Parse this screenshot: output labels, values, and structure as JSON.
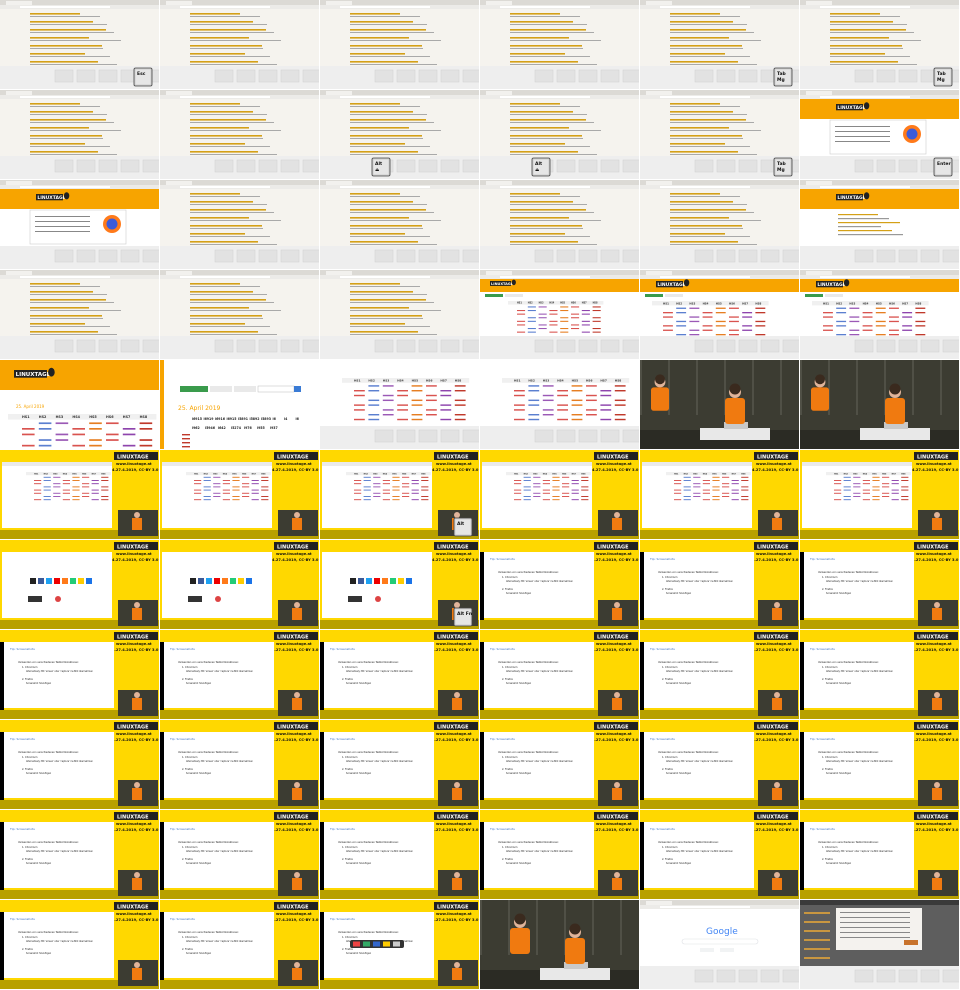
{
  "contact_sheet": {
    "columns": 6,
    "rows": 11,
    "frames": [
      {
        "type": "browser",
        "key": "Esc"
      },
      {
        "type": "browser"
      },
      {
        "type": "browser"
      },
      {
        "type": "browser"
      },
      {
        "type": "browser",
        "key": "Tab\nMg"
      },
      {
        "type": "browser",
        "key": "Tab\nMg"
      },
      {
        "type": "browser"
      },
      {
        "type": "browser"
      },
      {
        "type": "browser",
        "key": "Alt\n⏏"
      },
      {
        "type": "browser",
        "key": "Alt\n⏏"
      },
      {
        "type": "browser",
        "key": "Tab\nMg"
      },
      {
        "type": "lt_dialog",
        "key": "Enter"
      },
      {
        "type": "lt_dialog"
      },
      {
        "type": "browser"
      },
      {
        "type": "browser"
      },
      {
        "type": "browser"
      },
      {
        "type": "browser"
      },
      {
        "type": "lt_page"
      },
      {
        "type": "browser"
      },
      {
        "type": "browser"
      },
      {
        "type": "browser"
      },
      {
        "type": "lt_schedule"
      },
      {
        "type": "lt_schedule_zoom"
      },
      {
        "type": "lt_schedule_zoom"
      },
      {
        "type": "lt_schedule_big"
      },
      {
        "type": "zoom_date"
      },
      {
        "type": "schedule_plain"
      },
      {
        "type": "schedule_plain"
      },
      {
        "type": "speaker"
      },
      {
        "type": "speaker"
      },
      {
        "type": "stream_schedule"
      },
      {
        "type": "stream_schedule"
      },
      {
        "type": "stream_schedule",
        "key": "Alt"
      },
      {
        "type": "stream_schedule"
      },
      {
        "type": "stream_schedule"
      },
      {
        "type": "stream_schedule"
      },
      {
        "type": "stream_browser"
      },
      {
        "type": "stream_browser"
      },
      {
        "type": "stream_browser",
        "key": "Alt Fn"
      },
      {
        "type": "stream_slide"
      },
      {
        "type": "stream_slide"
      },
      {
        "type": "stream_slide"
      },
      {
        "type": "stream_slide"
      },
      {
        "type": "stream_slide"
      },
      {
        "type": "stream_slide"
      },
      {
        "type": "stream_slide"
      },
      {
        "type": "stream_slide"
      },
      {
        "type": "stream_slide"
      },
      {
        "type": "stream_slide"
      },
      {
        "type": "stream_slide"
      },
      {
        "type": "stream_slide"
      },
      {
        "type": "stream_slide"
      },
      {
        "type": "stream_slide"
      },
      {
        "type": "stream_slide"
      },
      {
        "type": "stream_slide"
      },
      {
        "type": "stream_slide"
      },
      {
        "type": "stream_slide"
      },
      {
        "type": "stream_slide"
      },
      {
        "type": "stream_slide"
      },
      {
        "type": "stream_slide"
      },
      {
        "type": "stream_slide"
      },
      {
        "type": "stream_slide"
      },
      {
        "type": "stream_slide_dock"
      },
      {
        "type": "speaker2"
      },
      {
        "type": "google"
      },
      {
        "type": "dark_dialog"
      }
    ]
  },
  "text": {
    "linuxtage": "LINUXTAGE",
    "stream_url": "www.linuxtage.at",
    "stream_license": "4.27.4.2019, CC-BY 3.0",
    "zoom_date": "25. April 2019",
    "google": "Google",
    "schedule_cols": [
      "HS1",
      "HS2",
      "HS3",
      "HS4",
      "HS5",
      "HS6",
      "HS7",
      "HS8"
    ],
    "zoom_row1": [
      "i6915",
      "i6919",
      "i6916",
      "i6915",
      "i5891",
      "i5892",
      "i5893",
      "i6",
      "i4",
      "i6"
    ],
    "zoom_row2": [
      "i962",
      "i5946",
      "i642",
      "i5274",
      "i976",
      "i955",
      "i937"
    ],
    "slide_heading": "Tip: Screenshots",
    "slide_lines": [
      "Verwenden von verschiedenen Tastkombinationen:",
      "Chromium",
      "Alternatively: Mit 'screen' oder 'capture' ins Bild übernehmen",
      "Firefox",
      "Screenshot hinzufügen"
    ]
  },
  "colors": {
    "orange": "#f7a400",
    "yellow": "#ffd800",
    "link": "#d4a017",
    "page_bg": "#f5f3ee",
    "dark_stage": "#3c3c32",
    "shirt": "#f07a10"
  }
}
